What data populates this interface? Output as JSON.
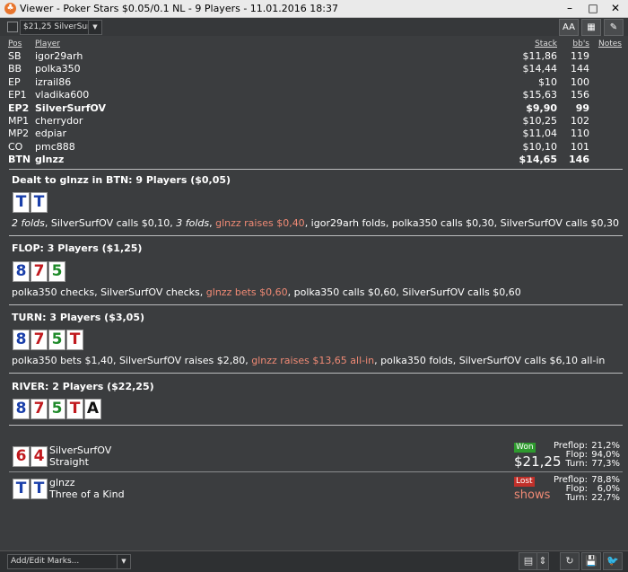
{
  "window": {
    "title": "Viewer - Poker Stars $0.05/0.1 NL - 9 Players - 11.01.2016 18:37",
    "minimize": "–",
    "maximize": "□",
    "close": "✕"
  },
  "toolbar": {
    "player_select": "$21,25 SilverSurfOV",
    "font_btn": "AA",
    "grid_btn": "▦",
    "edit_btn": "✎"
  },
  "players_table": {
    "headers": {
      "pos": "Pos",
      "player": "Player",
      "stack": "Stack",
      "bbs": "bb's",
      "notes": "Notes"
    },
    "rows": [
      {
        "pos": "SB",
        "player": "igor29arh",
        "stack": "$11,86",
        "bbs": "119",
        "bold": false
      },
      {
        "pos": "BB",
        "player": "polka350",
        "stack": "$14,44",
        "bbs": "144",
        "bold": false
      },
      {
        "pos": "EP",
        "player": "izrail86",
        "stack": "$10",
        "bbs": "100",
        "bold": false
      },
      {
        "pos": "EP1",
        "player": "vladika600",
        "stack": "$15,63",
        "bbs": "156",
        "bold": false
      },
      {
        "pos": "EP2",
        "player": "SilverSurfOV",
        "stack": "$9,90",
        "bbs": "99",
        "bold": true
      },
      {
        "pos": "MP1",
        "player": "cherrydor",
        "stack": "$10,25",
        "bbs": "102",
        "bold": false
      },
      {
        "pos": "MP2",
        "player": "edpiar",
        "stack": "$11,04",
        "bbs": "110",
        "bold": false
      },
      {
        "pos": "CO",
        "player": "pmc888",
        "stack": "$10,10",
        "bbs": "101",
        "bold": false
      },
      {
        "pos": "BTN",
        "player": "glnzz",
        "stack": "$14,65",
        "bbs": "146",
        "bold": true
      }
    ]
  },
  "streets": {
    "preflop": {
      "heading": "Dealt to glnzz in BTN: 9 Players ($0,05)",
      "cards": [
        {
          "rank": "T",
          "color": "#1a3faa"
        },
        {
          "rank": "T",
          "color": "#1a3faa"
        }
      ],
      "actions": [
        {
          "text": "2 folds",
          "style": "italic"
        },
        {
          "text": ", SilverSurfOV calls $0,10, ",
          "style": "normal"
        },
        {
          "text": "3 folds",
          "style": "italic"
        },
        {
          "text": ", ",
          "style": "normal"
        },
        {
          "text": "glnzz raises $0,40",
          "style": "hl"
        },
        {
          "text": ", igor29arh folds, polka350 calls $0,30, SilverSurfOV calls $0,30",
          "style": "normal"
        }
      ]
    },
    "flop": {
      "heading": "FLOP: 3 Players ($1,25)",
      "cards": [
        {
          "rank": "8",
          "color": "#1a3faa"
        },
        {
          "rank": "7",
          "color": "#c0191e"
        },
        {
          "rank": "5",
          "color": "#1f8a2a"
        }
      ],
      "actions": [
        {
          "text": "polka350 checks, SilverSurfOV checks, ",
          "style": "normal"
        },
        {
          "text": "glnzz bets $0,60",
          "style": "hl"
        },
        {
          "text": ", polka350 calls $0,60, SilverSurfOV calls $0,60",
          "style": "normal"
        }
      ]
    },
    "turn": {
      "heading": "TURN: 3 Players ($3,05)",
      "cards": [
        {
          "rank": "8",
          "color": "#1a3faa"
        },
        {
          "rank": "7",
          "color": "#c0191e"
        },
        {
          "rank": "5",
          "color": "#1f8a2a"
        },
        {
          "rank": "T",
          "color": "#c0191e"
        }
      ],
      "actions": [
        {
          "text": "polka350 bets $1,40, SilverSurfOV raises $2,80, ",
          "style": "normal"
        },
        {
          "text": "glnzz raises $13,65 all-in",
          "style": "hl"
        },
        {
          "text": ", polka350 folds, SilverSurfOV calls $6,10 all-in",
          "style": "normal"
        }
      ]
    },
    "river": {
      "heading": "RIVER: 2 Players ($22,25)",
      "cards": [
        {
          "rank": "8",
          "color": "#1a3faa"
        },
        {
          "rank": "7",
          "color": "#c0191e"
        },
        {
          "rank": "5",
          "color": "#1f8a2a"
        },
        {
          "rank": "T",
          "color": "#c0191e"
        },
        {
          "rank": "A",
          "color": "#111111"
        }
      ]
    }
  },
  "showdown": [
    {
      "player": "SilverSurfOV",
      "hand": "Straight",
      "cards": [
        {
          "rank": "6",
          "color": "#c0191e"
        },
        {
          "rank": "4",
          "color": "#c0191e"
        }
      ],
      "result": "Won",
      "result_color": "#2e9a2e",
      "amount": "$21,25",
      "amount_color": "#ffffff",
      "stats": [
        {
          "label": "Preflop:",
          "value": "21,2%"
        },
        {
          "label": "Flop:",
          "value": "94,0%"
        },
        {
          "label": "Turn:",
          "value": "77,3%"
        }
      ]
    },
    {
      "player": "glnzz",
      "hand": "Three of a Kind",
      "cards": [
        {
          "rank": "T",
          "color": "#1a3faa"
        },
        {
          "rank": "T",
          "color": "#1a3faa"
        }
      ],
      "result": "Lost",
      "result_color": "#c0302a",
      "amount": "shows",
      "amount_color": "#f08a75",
      "stats": [
        {
          "label": "Preflop:",
          "value": "78,8%"
        },
        {
          "label": "Flop:",
          "value": "6,0%"
        },
        {
          "label": "Turn:",
          "value": "22,7%"
        }
      ]
    }
  ],
  "statusbar": {
    "marks_select": "Add/Edit Marks...",
    "calc_btn": "▤",
    "stepper_btn": "⇕",
    "refresh_btn": "↻",
    "save_btn": "💾",
    "share_btn": "🐦"
  }
}
